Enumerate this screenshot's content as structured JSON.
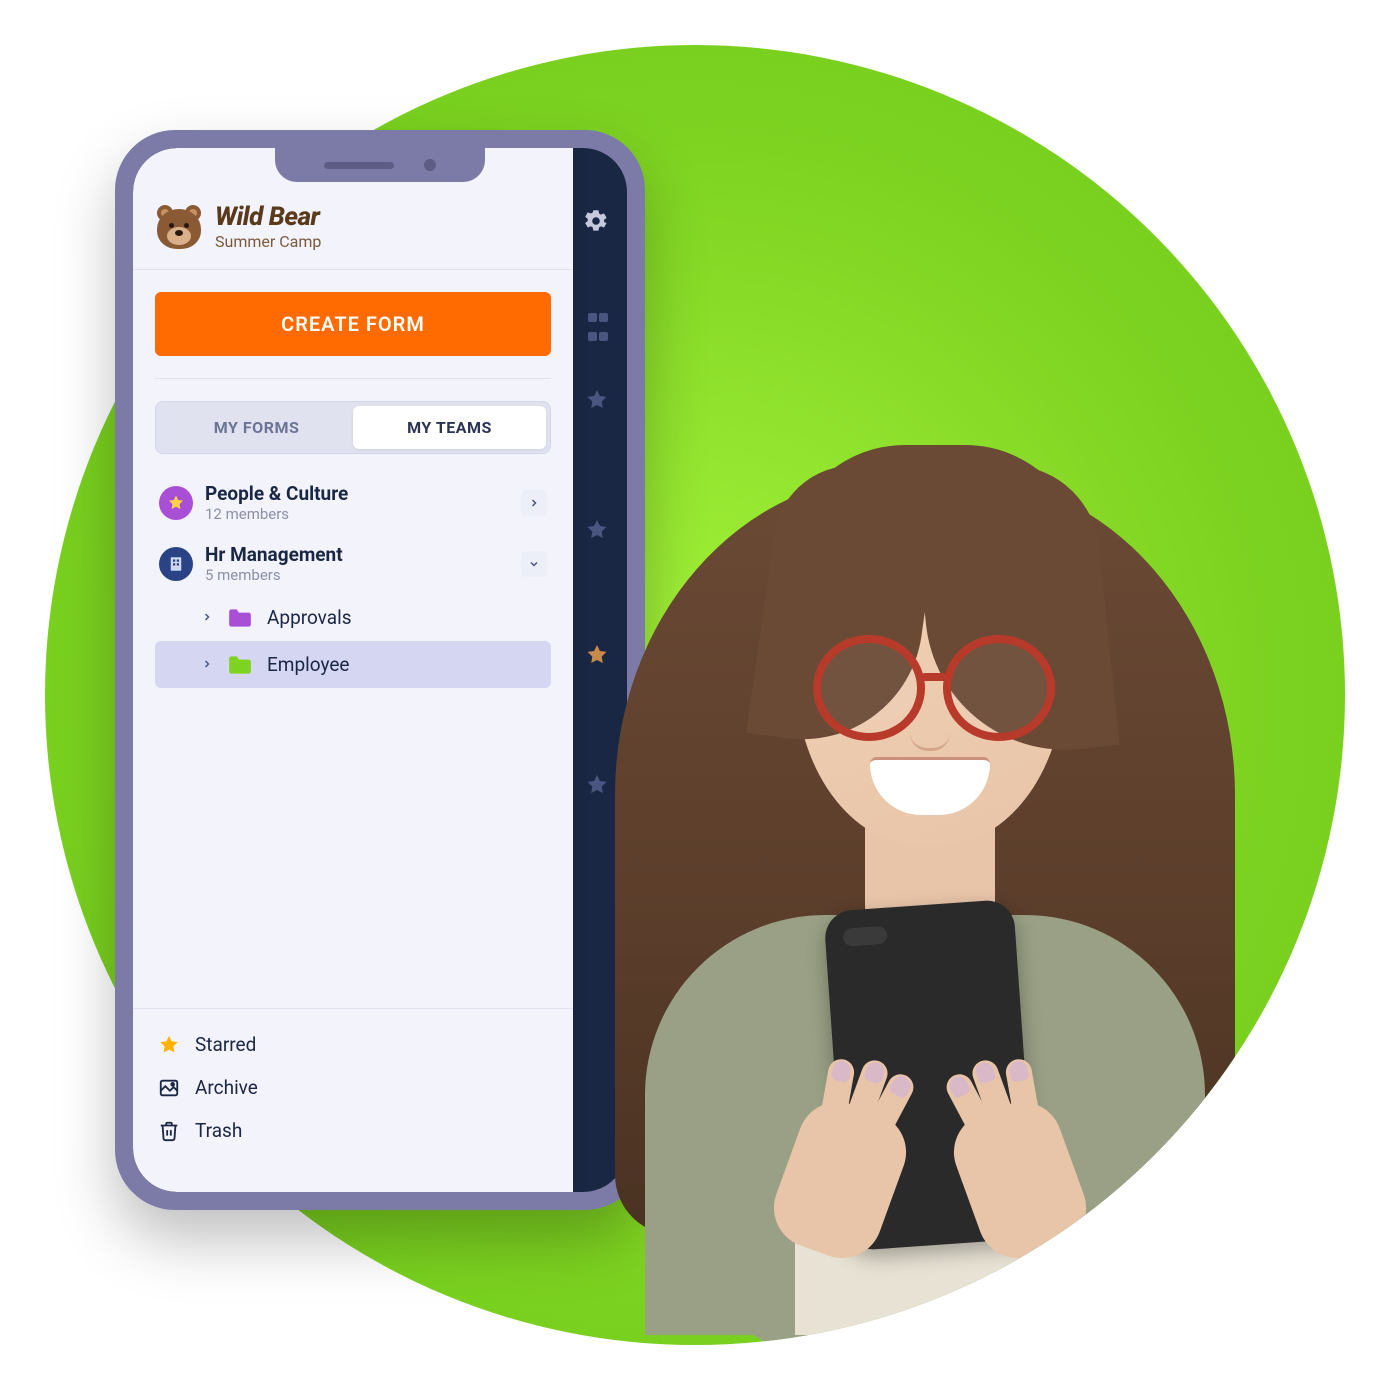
{
  "brand": {
    "title": "Wild Bear",
    "subtitle": "Summer Camp"
  },
  "create_button": "CREATE FORM",
  "tabs": {
    "my_forms": "MY FORMS",
    "my_teams": "MY TEAMS",
    "active": "my_teams"
  },
  "teams": [
    {
      "name": "People & Culture",
      "members": "12 members",
      "icon": "star-circle",
      "color": "purple",
      "expanded": false
    },
    {
      "name": "Hr Management",
      "members": "5 members",
      "icon": "building",
      "color": "navy",
      "expanded": true,
      "folders": [
        {
          "label": "Approvals",
          "color": "#a94fd6",
          "selected": false
        },
        {
          "label": "Employee",
          "color": "#7ed321",
          "selected": true
        }
      ]
    }
  ],
  "footer": {
    "starred": "Starred",
    "archive": "Archive",
    "trash": "Trash"
  }
}
